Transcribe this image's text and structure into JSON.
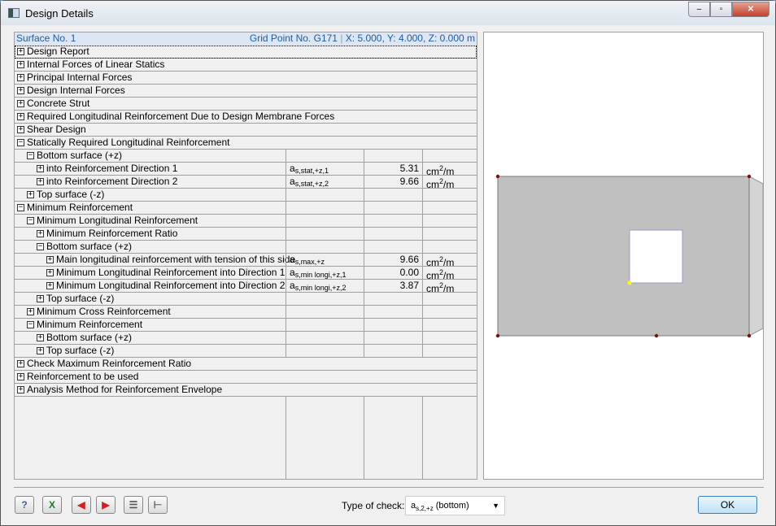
{
  "window": {
    "title": "Design Details",
    "min": "–",
    "max": "▫",
    "close": "✕"
  },
  "header": {
    "surface": "Surface No. 1",
    "grid_point": "Grid Point No. G171",
    "coords": "X: 5.000, Y: 4.000, Z: 0.000 m"
  },
  "rows": [
    {
      "level": 0,
      "state": "+",
      "label": "Design Report"
    },
    {
      "level": 0,
      "state": "+",
      "label": "Internal Forces of Linear Statics"
    },
    {
      "level": 0,
      "state": "+",
      "label": "Principal Internal Forces"
    },
    {
      "level": 0,
      "state": "+",
      "label": "Design Internal Forces"
    },
    {
      "level": 0,
      "state": "+",
      "label": "Concrete Strut"
    },
    {
      "level": 0,
      "state": "+",
      "label": "Required Longitudinal Reinforcement Due to Design Membrane Forces"
    },
    {
      "level": 0,
      "state": "+",
      "label": "Shear Design"
    },
    {
      "level": 0,
      "state": "-",
      "label": "Statically Required Longitudinal Reinforcement"
    },
    {
      "level": 1,
      "state": "-",
      "label": "Bottom surface (+z)"
    },
    {
      "level": 2,
      "state": "+",
      "label": "into Reinforcement Direction 1",
      "sym": "a",
      "sub": "s,stat,+z,1",
      "value": "5.31",
      "unit": "cm",
      "unit_sup": "2",
      "unit_tail": "/m"
    },
    {
      "level": 2,
      "state": "+",
      "label": "into Reinforcement Direction 2",
      "sym": "a",
      "sub": "s,stat,+z,2",
      "value": "9.66",
      "unit": "cm",
      "unit_sup": "2",
      "unit_tail": "/m"
    },
    {
      "level": 1,
      "state": "+",
      "label": "Top surface (-z)"
    },
    {
      "level": 0,
      "state": "-",
      "label": "Minimum Reinforcement"
    },
    {
      "level": 1,
      "state": "-",
      "label": "Minimum Longitudinal Reinforcement"
    },
    {
      "level": 2,
      "state": "+",
      "label": "Minimum Reinforcement Ratio"
    },
    {
      "level": 2,
      "state": "-",
      "label": "Bottom surface (+z)"
    },
    {
      "level": 3,
      "state": "+",
      "label": "Main longitudinal reinforcement with tension of this side",
      "sym": "a",
      "sub": "s,max,+z",
      "value": "9.66",
      "unit": "cm",
      "unit_sup": "2",
      "unit_tail": "/m"
    },
    {
      "level": 3,
      "state": "+",
      "label": "Minimum Longitudinal Reinforcement into Direction 1",
      "sym": "a",
      "sub": "s,min longi,+z,1",
      "value": "0.00",
      "unit": "cm",
      "unit_sup": "2",
      "unit_tail": "/m"
    },
    {
      "level": 3,
      "state": "+",
      "label": "Minimum Longitudinal Reinforcement into Direction 2",
      "sym": "a",
      "sub": "s,min longi,+z,2",
      "value": "3.87",
      "unit": "cm",
      "unit_sup": "2",
      "unit_tail": "/m"
    },
    {
      "level": 2,
      "state": "+",
      "label": "Top surface (-z)"
    },
    {
      "level": 1,
      "state": "+",
      "label": "Minimum Cross Reinforcement"
    },
    {
      "level": 1,
      "state": "-",
      "label": "Minimum Reinforcement"
    },
    {
      "level": 2,
      "state": "+",
      "label": "Bottom surface (+z)"
    },
    {
      "level": 2,
      "state": "+",
      "label": "Top surface (-z)"
    },
    {
      "level": 0,
      "state": "+",
      "label": "Check Maximum Reinforcement Ratio"
    },
    {
      "level": 0,
      "state": "+",
      "label": "Reinforcement to be used"
    },
    {
      "level": 0,
      "state": "+",
      "label": "Analysis Method for Reinforcement Envelope"
    }
  ],
  "footer": {
    "type_label": "Type of check:",
    "type_sym": "a",
    "type_sub": "s,2,+z",
    "type_tail": " (bottom)",
    "ok": "OK",
    "buttons": [
      {
        "name": "help",
        "glyph": "?"
      },
      {
        "name": "excel",
        "glyph": "X"
      },
      {
        "name": "previous",
        "glyph": "◀"
      },
      {
        "name": "next",
        "glyph": "▶"
      },
      {
        "name": "list",
        "glyph": "☰"
      },
      {
        "name": "tree",
        "glyph": "⊢"
      }
    ]
  },
  "colors": {
    "surface": "#c0c0c0",
    "node": "#7a1010",
    "selected_point": "#ffff00"
  }
}
